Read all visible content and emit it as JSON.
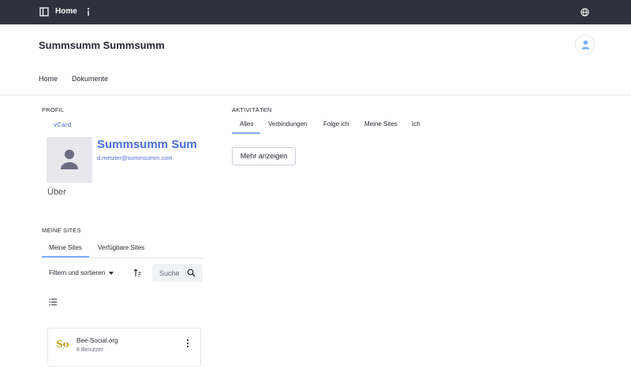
{
  "topbar": {
    "breadcrumb": "Home"
  },
  "header": {
    "title": "Summsumm Summsumm",
    "nav": [
      "Home",
      "Dokumente"
    ]
  },
  "profile": {
    "section_label": "PROFIL",
    "vcard_link": "vCard",
    "name": "Summsumm Sum",
    "email": "d.metzler@summsumm.com",
    "about": "Über"
  },
  "activities": {
    "section_label": "AKTIVITÄTEN",
    "tabs": [
      "Alles",
      "Verbindungen",
      "Folge ich",
      "Meine Sites",
      "Ich"
    ],
    "active_tab": "Alles",
    "more_button": "Mehr anzeigen"
  },
  "sites": {
    "section_label": "MEINE SITES",
    "tabs": [
      "Meine Sites",
      "Verfügbare Sites"
    ],
    "active_tab": "Meine Sites",
    "filter_label": "Filtern und sortieren",
    "search_placeholder": "Suche",
    "items": [
      {
        "logo_text": "So",
        "name": "Bee-Social.org",
        "members": "8 Benutzer"
      }
    ]
  },
  "colors": {
    "topbar": "#30313f",
    "accent": "#4b6fde",
    "tab_indicator": "#80acff",
    "logo_gold": "#c9a227"
  },
  "icons": [
    "sidebar-toggle-icon",
    "info-icon",
    "globe-icon",
    "user-icon",
    "sort-icon",
    "search-icon",
    "list-view-icon",
    "kebab-menu-icon"
  ]
}
